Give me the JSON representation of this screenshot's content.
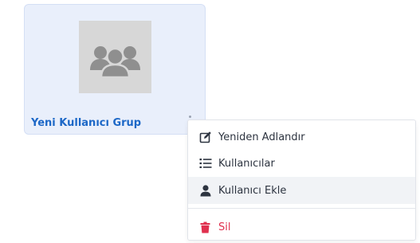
{
  "group_card": {
    "title": "Yeni Kullanıcı Grup",
    "avatar_icon": "users-group-icon",
    "menu_icon": "kebab-menu-icon"
  },
  "context_menu": {
    "items": [
      {
        "label": "Yeniden Adlandır",
        "icon": "edit-icon"
      },
      {
        "label": "Kullanıcılar",
        "icon": "list-icon"
      },
      {
        "label": "Kullanıcı Ekle",
        "icon": "user-icon",
        "highlighted": true
      },
      {
        "label": "Sil",
        "icon": "trash-icon",
        "danger": true
      }
    ]
  },
  "colors": {
    "card_background": "#e9effb",
    "title_blue": "#1d68c7",
    "danger_red": "#e0304e",
    "hover_gray": "#f1f3f6",
    "avatar_gray": "#8f8f8f"
  }
}
